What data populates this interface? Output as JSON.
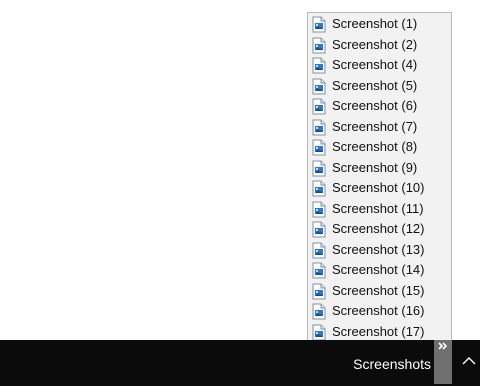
{
  "menu": {
    "items": [
      {
        "label": "Screenshot (1)",
        "icon": "image-file-icon"
      },
      {
        "label": "Screenshot (2)",
        "icon": "image-file-icon"
      },
      {
        "label": "Screenshot (4)",
        "icon": "image-file-icon"
      },
      {
        "label": "Screenshot (5)",
        "icon": "image-file-icon"
      },
      {
        "label": "Screenshot (6)",
        "icon": "image-file-icon"
      },
      {
        "label": "Screenshot (7)",
        "icon": "image-file-icon"
      },
      {
        "label": "Screenshot (8)",
        "icon": "image-file-icon"
      },
      {
        "label": "Screenshot (9)",
        "icon": "image-file-icon"
      },
      {
        "label": "Screenshot (10)",
        "icon": "image-file-icon"
      },
      {
        "label": "Screenshot (11)",
        "icon": "image-file-icon"
      },
      {
        "label": "Screenshot (12)",
        "icon": "image-file-icon"
      },
      {
        "label": "Screenshot (13)",
        "icon": "image-file-icon"
      },
      {
        "label": "Screenshot (14)",
        "icon": "image-file-icon"
      },
      {
        "label": "Screenshot (15)",
        "icon": "image-file-icon"
      },
      {
        "label": "Screenshot (16)",
        "icon": "image-file-icon"
      },
      {
        "label": "Screenshot (17)",
        "icon": "image-file-icon"
      }
    ]
  },
  "taskbar": {
    "toolbar_label": "Screenshots",
    "chevron_icon": "double-chevron-icon",
    "tray_icon": "chevron-up-icon"
  },
  "colors": {
    "menu_background": "#f2f2f2",
    "taskbar_background": "#0b0b0b",
    "chevron_button_background": "#6f6f6f",
    "icon_accent": "#2b78d0"
  }
}
